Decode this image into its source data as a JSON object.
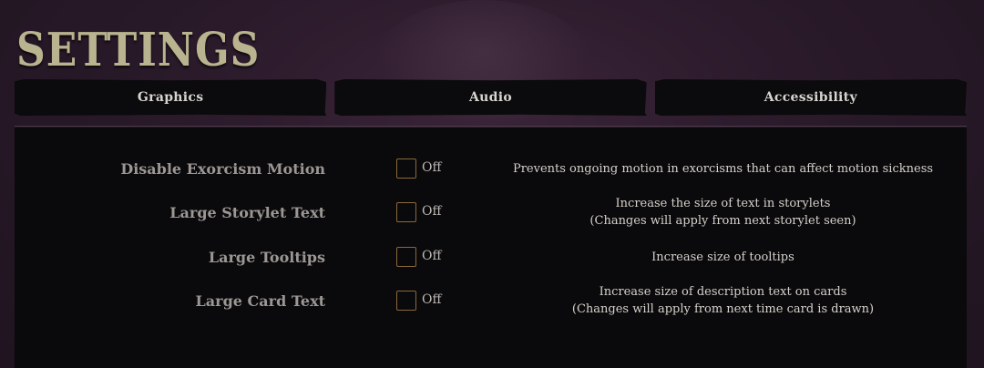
{
  "title": "SETTINGS",
  "tabs": [
    {
      "label": "Graphics"
    },
    {
      "label": "Audio"
    },
    {
      "label": "Accessibility"
    }
  ],
  "settings": [
    {
      "label": "Disable Exorcism Motion",
      "state": "Off",
      "desc": [
        "Prevents ongoing motion in exorcisms that can affect motion sickness"
      ]
    },
    {
      "label": "Large Storylet Text",
      "state": "Off",
      "desc": [
        "Increase the size of text in storylets",
        "(Changes will apply from next storylet seen)"
      ]
    },
    {
      "label": "Large Tooltips",
      "state": "Off",
      "desc": [
        "Increase size of tooltips"
      ]
    },
    {
      "label": "Large Card Text",
      "state": "Off",
      "desc": [
        "Increase size of description text on cards",
        "(Changes will apply from next time card is drawn)"
      ]
    }
  ],
  "colors": {
    "title": "#b9b48f",
    "toggle_border": "#8a6a3a",
    "panel": "#0a090b"
  }
}
